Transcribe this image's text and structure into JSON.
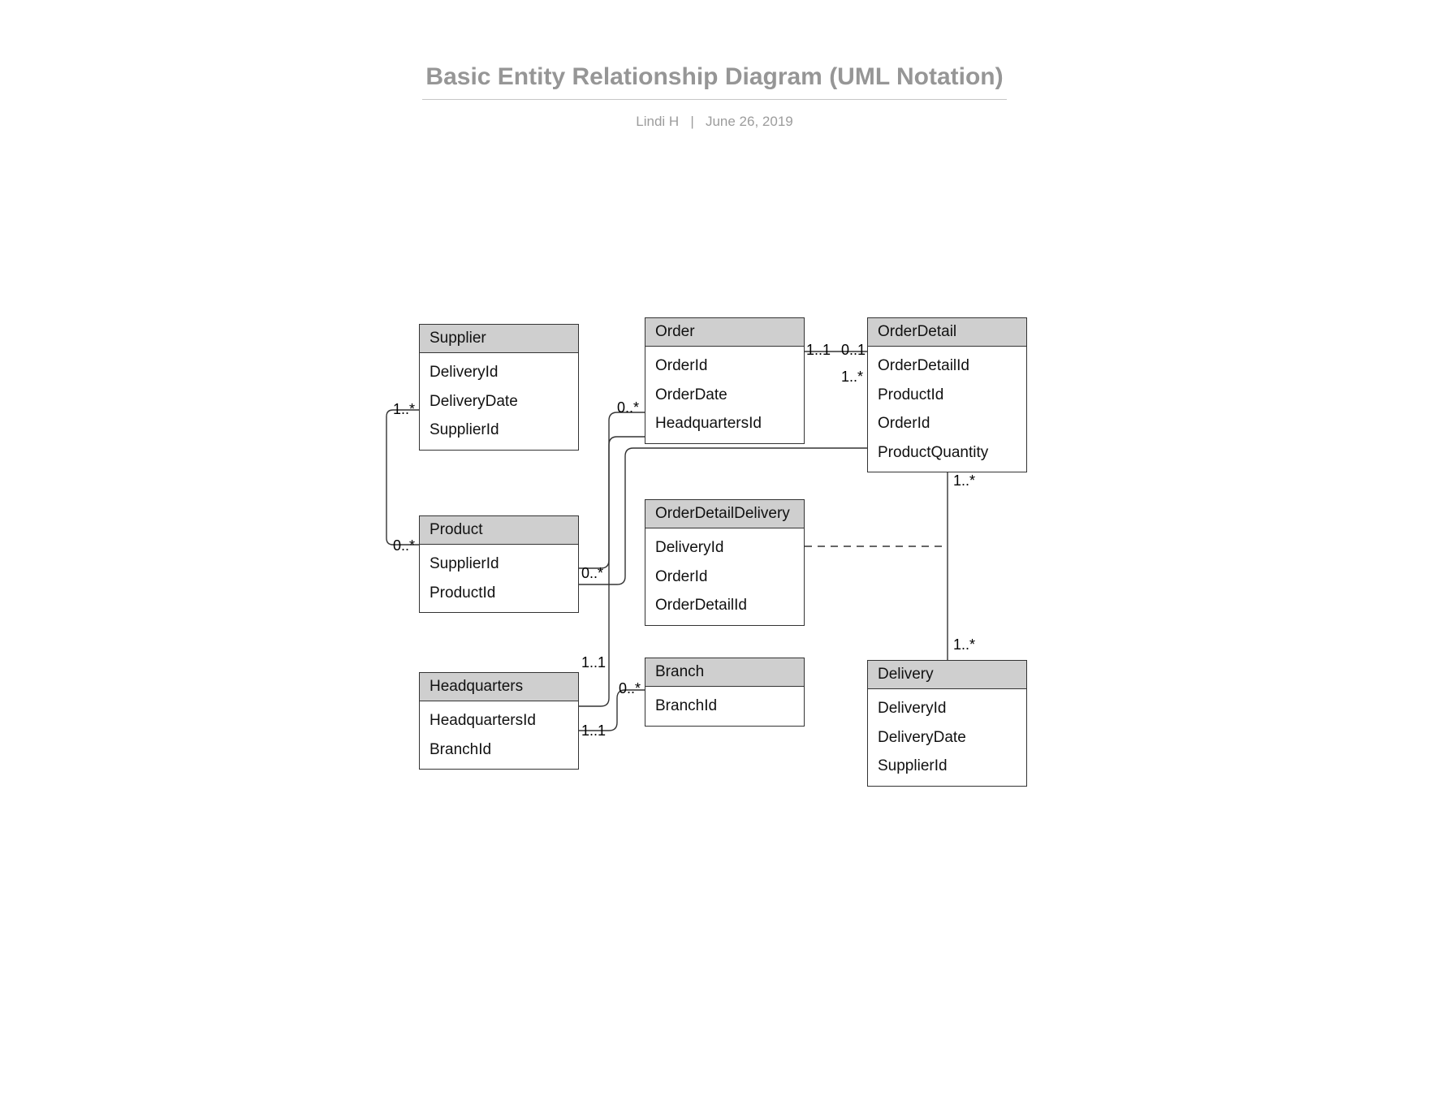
{
  "header": {
    "title": "Basic Entity Relationship Diagram (UML Notation)",
    "author": "Lindi H",
    "sep": "|",
    "date": "June 26, 2019"
  },
  "entities": {
    "supplier": {
      "name": "Supplier",
      "fields": [
        "DeliveryId",
        "DeliveryDate",
        "SupplierId"
      ]
    },
    "order": {
      "name": "Order",
      "fields": [
        "OrderId",
        "OrderDate",
        "HeadquartersId"
      ]
    },
    "orderDetail": {
      "name": "OrderDetail",
      "fields": [
        "OrderDetailId",
        "ProductId",
        "OrderId",
        "ProductQuantity"
      ]
    },
    "product": {
      "name": "Product",
      "fields": [
        "SupplierId",
        "ProductId"
      ]
    },
    "orderDetailDelivery": {
      "name": "OrderDetailDelivery",
      "fields": [
        "DeliveryId",
        "OrderId",
        "OrderDetailId"
      ]
    },
    "headquarters": {
      "name": "Headquarters",
      "fields": [
        "HeadquartersId",
        "BranchId"
      ]
    },
    "branch": {
      "name": "Branch",
      "fields": [
        "BranchId"
      ]
    },
    "delivery": {
      "name": "Delivery",
      "fields": [
        "DeliveryId",
        "DeliveryDate",
        "SupplierId"
      ]
    }
  },
  "mults": {
    "supplier_right": "1..*",
    "product_left": "0..*",
    "product_right": "0..*",
    "order_left": "0..*",
    "order_right": "1..1",
    "orderDetail_left": "0..1",
    "orderDetail_rightTop": "1..*",
    "orderDetail_bottom": "1..*",
    "delivery_top": "1..*",
    "hq_rightTop": "1..1",
    "hq_rightBot": "1..1",
    "branch_left": "0..*"
  },
  "relationships": [
    {
      "from": "Supplier",
      "to": "Product",
      "mult_from": "1..*",
      "mult_to": "0..*",
      "style": "solid"
    },
    {
      "from": "Product",
      "to": "Order",
      "mult_from": "0..*",
      "mult_to": "0..*",
      "style": "solid"
    },
    {
      "from": "Order",
      "to": "OrderDetail",
      "mult_from": "1..1",
      "mult_to": "0..1",
      "style": "solid"
    },
    {
      "from": "Product",
      "to": "OrderDetail",
      "style": "solid",
      "mult_to": "1..*"
    },
    {
      "from": "OrderDetail",
      "to": "Delivery",
      "mult_from": "1..*",
      "mult_to": "1..*",
      "style": "solid"
    },
    {
      "from": "OrderDetailDelivery",
      "to": "OrderDetail-Delivery",
      "style": "dashed",
      "note": "association class"
    },
    {
      "from": "Headquarters",
      "to": "Order",
      "mult": "1..1",
      "style": "solid"
    },
    {
      "from": "Headquarters",
      "to": "Branch",
      "mult_from": "1..1",
      "mult_to": "0..*",
      "style": "solid"
    }
  ]
}
